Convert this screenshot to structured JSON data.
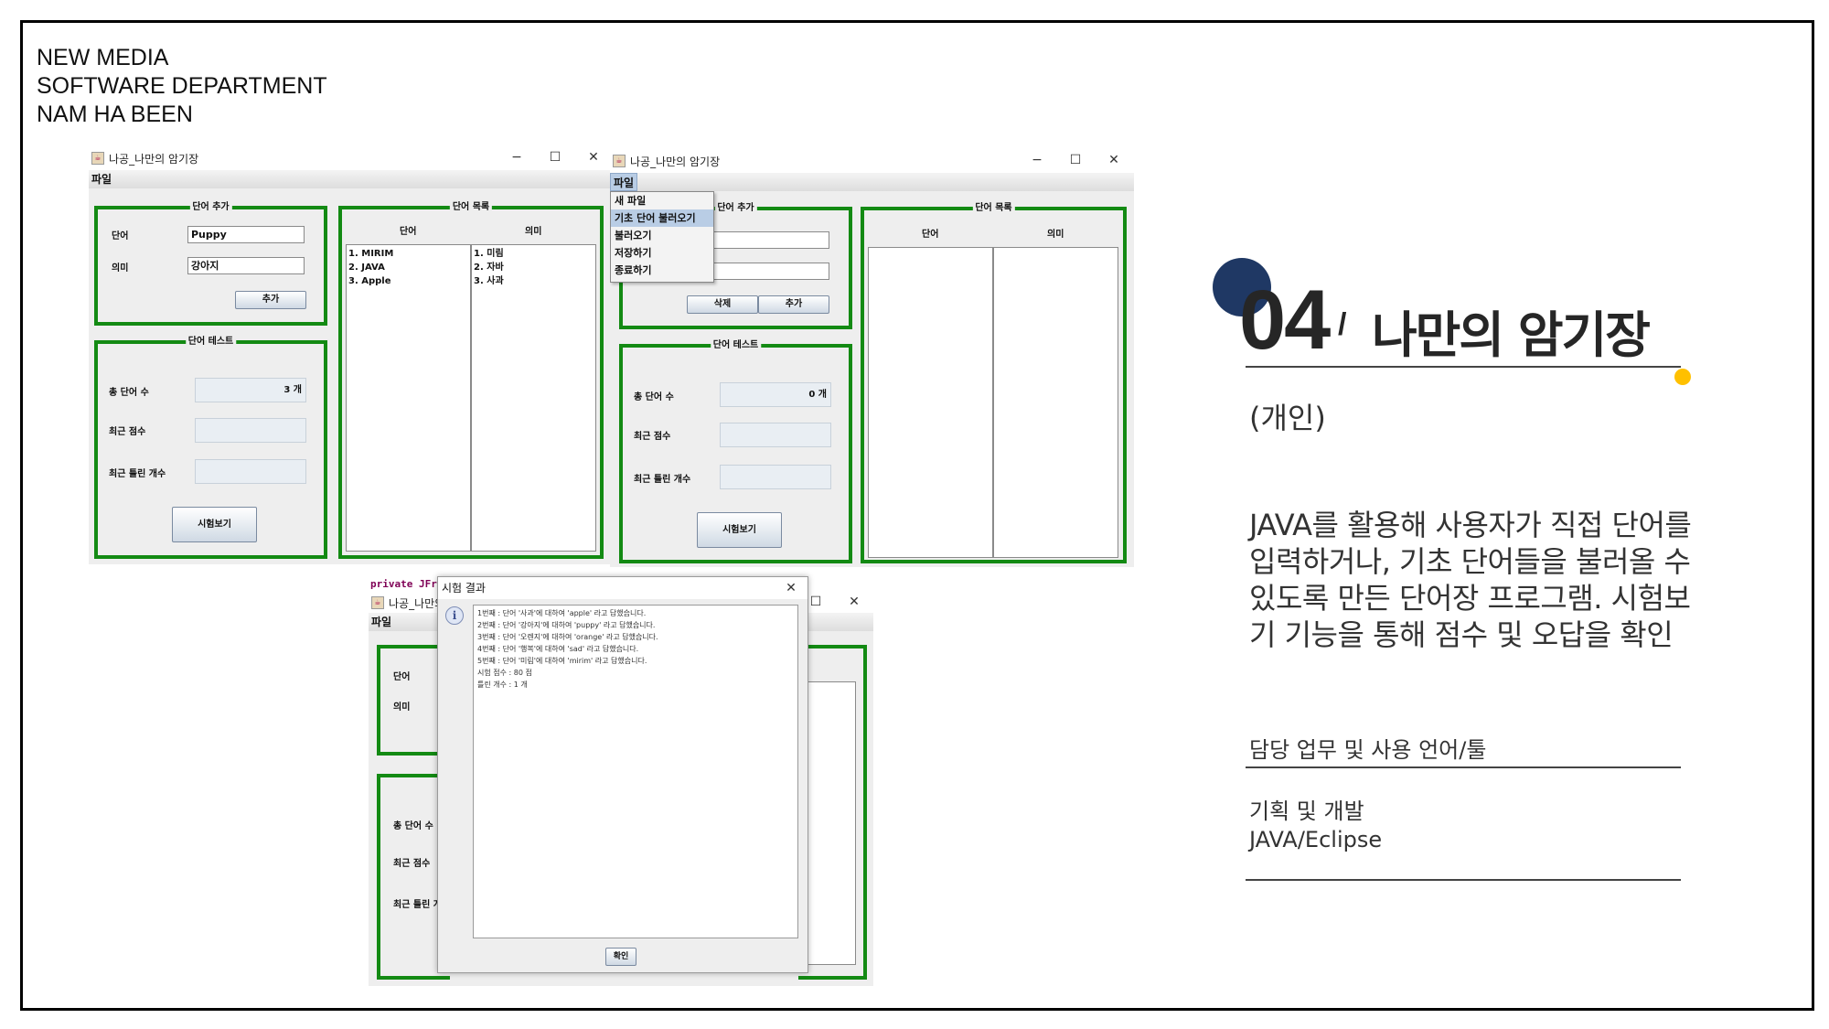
{
  "header": {
    "line1": "NEW MEDIA",
    "line2": "SOFTWARE DEPARTMENT",
    "line3": "NAM HA BEEN"
  },
  "window_title": "나공_나만의 암기장",
  "menu_file": "파일",
  "window_controls": {
    "minimize": "−",
    "maximize": "☐",
    "close": "✕"
  },
  "win1": {
    "add_panel_title": "단어 추가",
    "word_label": "단어",
    "meaning_label": "의미",
    "word_value": "Puppy",
    "meaning_value": "강아지",
    "add_button": "추가",
    "test_panel_title": "단어 테스트",
    "total_label": "총 단어 수",
    "total_value": "3 개",
    "recent_score_label": "최근 점수",
    "recent_wrong_label": "최근 틀린 개수",
    "test_button": "시험보기",
    "list_panel_title": "단어 목록",
    "col_word": "단어",
    "col_meaning": "의미",
    "words": [
      "1. MIRIM",
      "2. JAVA",
      "3. Apple"
    ],
    "meanings": [
      "1. 미림",
      "2. 자바",
      "3. 사과"
    ]
  },
  "win2": {
    "menu_items": [
      "새 파일",
      "기초 단어 불러오기",
      "불러오기",
      "저장하기",
      "종료하기"
    ],
    "add_panel_title": "단어 추가",
    "delete_button": "삭제",
    "add_button": "추가",
    "test_panel_title": "단어 테스트",
    "total_label": "총 단어 수",
    "total_value": "0 개",
    "recent_score_label": "최근 점수",
    "recent_wrong_label": "최근 틀린 개수",
    "test_button": "시험보기",
    "list_panel_title": "단어 목록",
    "col_word": "단어",
    "col_meaning": "의미"
  },
  "win3": {
    "code_snippet": "private JFr",
    "title_partial": "나공_나만의",
    "word_label": "단어",
    "meaning_label": "의미",
    "total_label": "총 단어 수",
    "recent_score_label": "최근 점수",
    "recent_wrong_label": "최근 틀린 개",
    "dialog_title": "시험 결과",
    "result_lines": [
      "1번째 : 단어 '사과'에 대하여 'apple' 라고 답했습니다.",
      "2번째 : 단어 '강아지'에 대하여 'puppy' 라고 답했습니다.",
      "3번째 : 단어 '오렌지'에 대하여 'orange' 라고 답했습니다.",
      "4번째 : 단어 '행복'에 대하여 'sad' 라고 답했습니다.",
      "5번째 : 단어 '미림'에 대하여 'mirim' 라고 답했습니다.",
      "시험 점수 : 80 점",
      "틀린 개수 : 1 개"
    ],
    "ok_button": "확인"
  },
  "section": {
    "number": "04",
    "slash": "/",
    "title": "나만의 암기장",
    "subtitle": "(개인)",
    "description": "JAVA를 활용해 사용자가 직접 단어를 입력하거나, 기초 단어들을 불러올 수 있도록 만든 단어장 프로그램. 시험보기 기능을 통해 점수 및 오답을 확인",
    "role_heading": "담당 업무 및 사용 언어/툴",
    "role_line1": "기획 및 개발",
    "role_line2": "JAVA/Eclipse"
  },
  "colors": {
    "panel_green": "#138a13",
    "navy": "#1f3864",
    "yellow": "#ffc000"
  }
}
